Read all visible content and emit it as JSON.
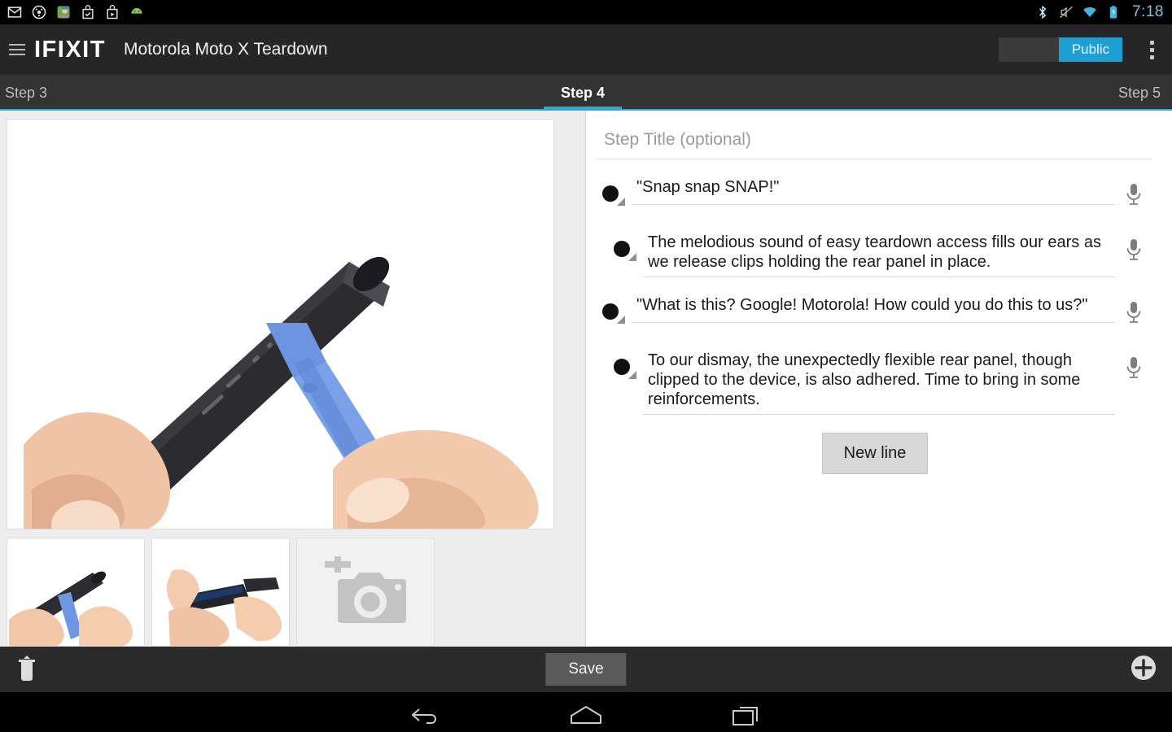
{
  "statusbar": {
    "notification_icons": [
      "gmail-icon",
      "disc-icon",
      "game-icon",
      "tasks-icon",
      "play-store-icon",
      "android-icon"
    ],
    "system_icons": [
      "bluetooth-icon",
      "volume-muted-icon",
      "wifi-icon",
      "battery-charging-icon"
    ],
    "time": "7:18"
  },
  "appbar": {
    "menu_icon": "hamburger-icon",
    "brand": "IFIXIT",
    "guide_title": "Motorola Moto X Teardown",
    "visibility_toggle": {
      "value": "Public",
      "active_color": "#1e9fd4"
    },
    "overflow_icon": "overflow-menu-icon"
  },
  "tabs": {
    "accent_color": "#2cabe2",
    "items": [
      {
        "label": "Step 3",
        "active": false
      },
      {
        "label": "Step 4",
        "active": true
      },
      {
        "label": "Step 5",
        "active": false
      }
    ]
  },
  "media": {
    "hero_alt": "Hand prying blue plastic opening tool into edge of black Moto X",
    "thumbnails": [
      {
        "alt": "Blue opening tool at phone edge"
      },
      {
        "alt": "Rear panel separated from device"
      }
    ],
    "add_photo": {
      "icon": "add-photo-camera-icon"
    }
  },
  "step": {
    "title_placeholder": "Step Title (optional)",
    "title_value": "",
    "bullets": [
      {
        "text": "\"Snap snap SNAP!\"",
        "indent": 1,
        "marker": "black-bullet",
        "mic_icon": "microphone-icon"
      },
      {
        "text": "The melodious sound of easy teardown access fills our ears as we release clips holding the rear panel in place.",
        "indent": 2,
        "marker": "black-bullet",
        "mic_icon": "microphone-icon"
      },
      {
        "text": "\"What is this? Google! Motorola! How could you do this to us?\"",
        "indent": 1,
        "marker": "black-bullet",
        "mic_icon": "microphone-icon"
      },
      {
        "text": "To our dismay, the unexpectedly flexible rear panel, though clipped to the device, is also adhered. Time to bring in some reinforcements.",
        "indent": 2,
        "marker": "black-bullet",
        "mic_icon": "microphone-icon"
      }
    ],
    "new_line_button": "New line"
  },
  "actionbar": {
    "delete_icon": "trash-icon",
    "save_label": "Save",
    "add_icon": "plus-circle-icon"
  },
  "navbar": {
    "back_icon": "back-icon",
    "home_icon": "home-icon",
    "recents_icon": "recents-icon"
  }
}
